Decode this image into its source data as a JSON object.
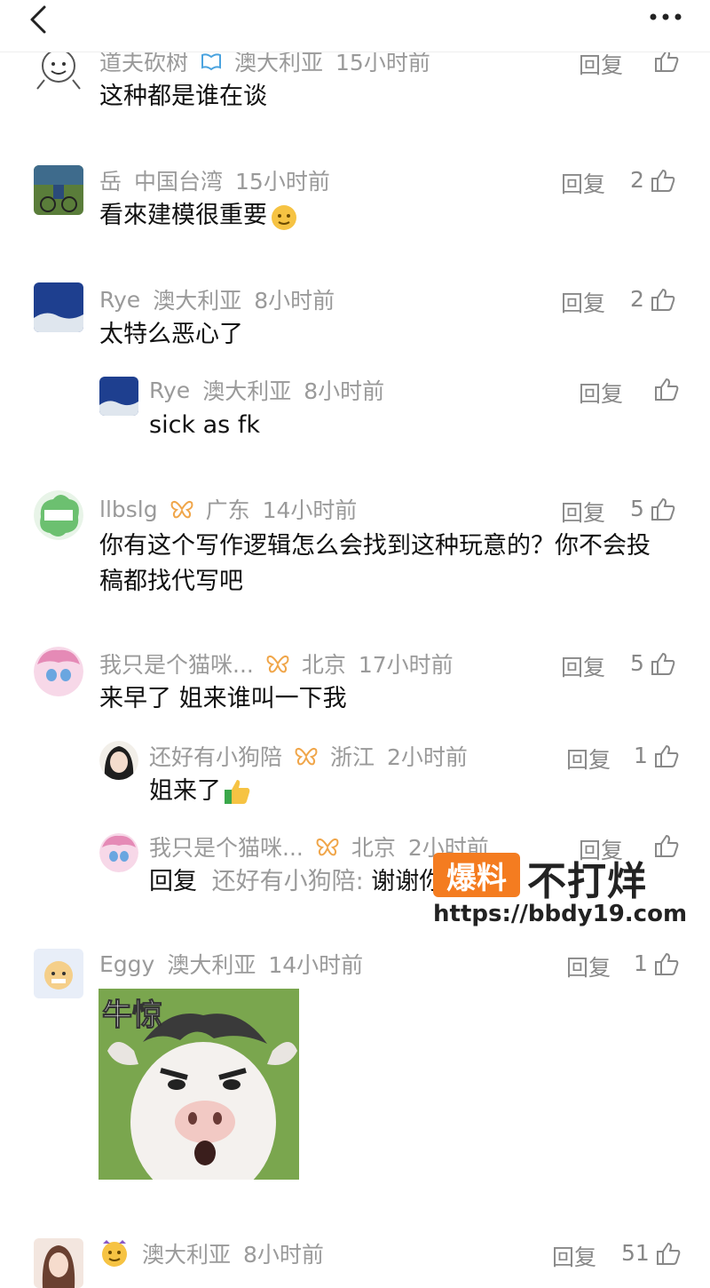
{
  "topbar": {
    "back_icon": "chevron-left-icon",
    "more_icon": "more-dots-icon"
  },
  "comments": [
    {
      "user": "道夫砍树",
      "badge": "book-badge-icon",
      "location": "澳大利亚",
      "time": "15小时前",
      "text": "这种都是谁在谈",
      "reply": "回复",
      "likes": ""
    },
    {
      "user": "岳",
      "location": "中国台湾",
      "time": "15小时前",
      "text": "看來建模很重要",
      "reply": "回复",
      "likes": "2"
    },
    {
      "user": "Rye",
      "location": "澳大利亚",
      "time": "8小时前",
      "text": "太特么恶心了",
      "reply": "回复",
      "likes": "2"
    },
    {
      "user": "Rye",
      "location": "澳大利亚",
      "time": "8小时前",
      "text": "sick as fk",
      "reply": "回复",
      "likes": ""
    },
    {
      "user": "llbslg",
      "badge": "butterfly-badge-icon",
      "location": "广东",
      "time": "14小时前",
      "text_line1": "你有这个写作逻辑怎么会找到这种玩意的？你不会投",
      "text_line2": "稿都找代写吧",
      "reply": "回复",
      "likes": "5"
    },
    {
      "user": "我只是个猫咪...",
      "badge": "butterfly-badge-icon",
      "location": "北京",
      "time": "17小时前",
      "text": "来早了 姐来谁叫一下我",
      "reply": "回复",
      "likes": "5"
    },
    {
      "user": "还好有小狗陪",
      "badge": "butterfly-badge-icon",
      "location": "浙江",
      "time": "2小时前",
      "text": "姐来了",
      "reply": "回复",
      "likes": "1"
    },
    {
      "user": "我只是个猫咪...",
      "badge": "butterfly-badge-icon",
      "location": "北京",
      "time": "2小时前",
      "reply_prefix": "回复",
      "reply_to": "还好有小狗陪:",
      "text": "谢谢你",
      "reply": "回复",
      "likes": ""
    },
    {
      "user": "Eggy",
      "location": "澳大利亚",
      "time": "14小时前",
      "sticker_label": "牛惊",
      "reply": "回复",
      "likes": "1"
    },
    {
      "location": "澳大利亚",
      "time": "8小时前",
      "reply": "回复",
      "likes": "51"
    }
  ],
  "watermark": {
    "badge": "爆料",
    "text": "不打烊",
    "url": "https://bbdy19.com"
  },
  "colors": {
    "meta_gray": "#9a9a9a",
    "badge_blue": "#4aa3df",
    "badge_orange": "#f0a64a",
    "watermark_orange": "#f47c20"
  }
}
